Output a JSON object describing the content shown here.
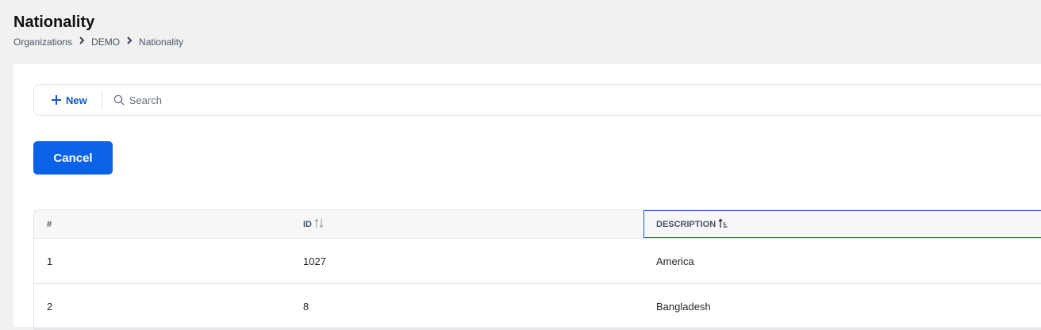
{
  "page": {
    "title": "Nationality"
  },
  "breadcrumb": {
    "items": [
      "Organizations",
      "DEMO",
      "Nationality"
    ]
  },
  "toolbar": {
    "new_label": "New",
    "search_placeholder": "Search",
    "search_value": ""
  },
  "actions": {
    "cancel_label": "Cancel"
  },
  "table": {
    "headers": [
      "#",
      "ID",
      "DESCRIPTION"
    ],
    "sort": {
      "column": "DESCRIPTION",
      "direction": "ascending"
    },
    "rows": [
      {
        "num": "1",
        "id": "1027",
        "description": "America"
      },
      {
        "num": "2",
        "id": "8",
        "description": "Bangladesh"
      }
    ]
  },
  "colors": {
    "accent": "#0a63e6",
    "link": "#0b57d0",
    "selected_border": "#1d5fc9",
    "background": "#f1f1f1"
  },
  "icons": [
    "chevron-right-icon",
    "plus-icon",
    "search-icon",
    "sort-neutral-icon",
    "sort-ascending-icon"
  ]
}
